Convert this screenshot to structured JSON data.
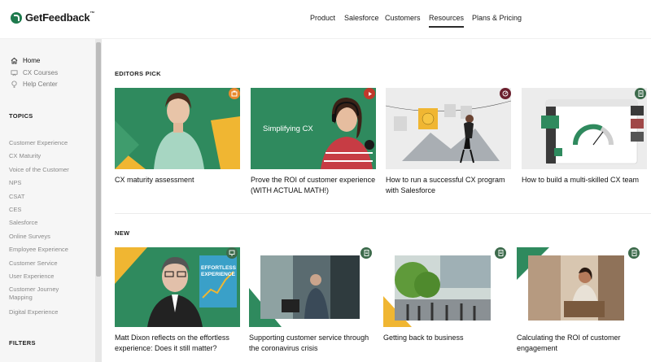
{
  "header": {
    "logo_text": "GetFeedback",
    "logo_tm": "™",
    "nav": [
      {
        "label": "Product"
      },
      {
        "label": "Salesforce"
      },
      {
        "label": "Customers"
      },
      {
        "label": "Resources"
      },
      {
        "label": "Plans & Pricing"
      }
    ]
  },
  "sidebar": {
    "links": [
      {
        "label": "Home",
        "icon": "home-icon"
      },
      {
        "label": "CX Courses",
        "icon": "courses-icon"
      },
      {
        "label": "Help Center",
        "icon": "lightbulb-icon"
      }
    ],
    "topics_heading": "TOPICS",
    "topics": [
      "Customer Experience",
      "CX Maturity",
      "Voice of the Customer",
      "NPS",
      "CSAT",
      "CES",
      "Salesforce",
      "Online Surveys",
      "Employee Experience",
      "Customer Service",
      "User Experience",
      "Customer Journey Mapping",
      "Digital Experience"
    ],
    "filters_heading": "FILTERS"
  },
  "editors_pick": {
    "label": "EDITORS PICK",
    "cards": [
      {
        "title": "CX maturity assessment",
        "badge_icon": "assessment-icon",
        "badge_color": "#e8892d"
      },
      {
        "title": "Prove the ROI of customer experience (WITH ACTUAL MATH!)",
        "image_text": "Simplifying CX",
        "badge_icon": "play-icon",
        "badge_color": "#c0392b"
      },
      {
        "title": "How to run a successful CX program with Salesforce",
        "badge_icon": "compass-icon",
        "badge_color": "#6b1f2e"
      },
      {
        "title": "How to build a multi-skilled CX team",
        "badge_icon": "document-icon",
        "badge_color": "#3d6b4c"
      }
    ]
  },
  "new": {
    "label": "NEW",
    "cards": [
      {
        "title": "Matt Dixon reflects on the effortless experience: Does it still matter?",
        "book_text": "EFFORTLESS EXPERIENCE",
        "badge_icon": "monitor-icon",
        "badge_color": "#3d6b4c"
      },
      {
        "title": "Supporting customer service through the coronavirus crisis",
        "badge_icon": "document-icon",
        "badge_color": "#3d6b4c"
      },
      {
        "title": "Getting back to business",
        "badge_icon": "document-icon",
        "badge_color": "#3d6b4c"
      },
      {
        "title": "Calculating the ROI of customer engagement",
        "badge_icon": "document-icon",
        "badge_color": "#3d6b4c"
      }
    ]
  },
  "colors": {
    "brand_green": "#1e7a4d",
    "card_green": "#2f8a5e",
    "accent_yellow": "#f0b632"
  }
}
